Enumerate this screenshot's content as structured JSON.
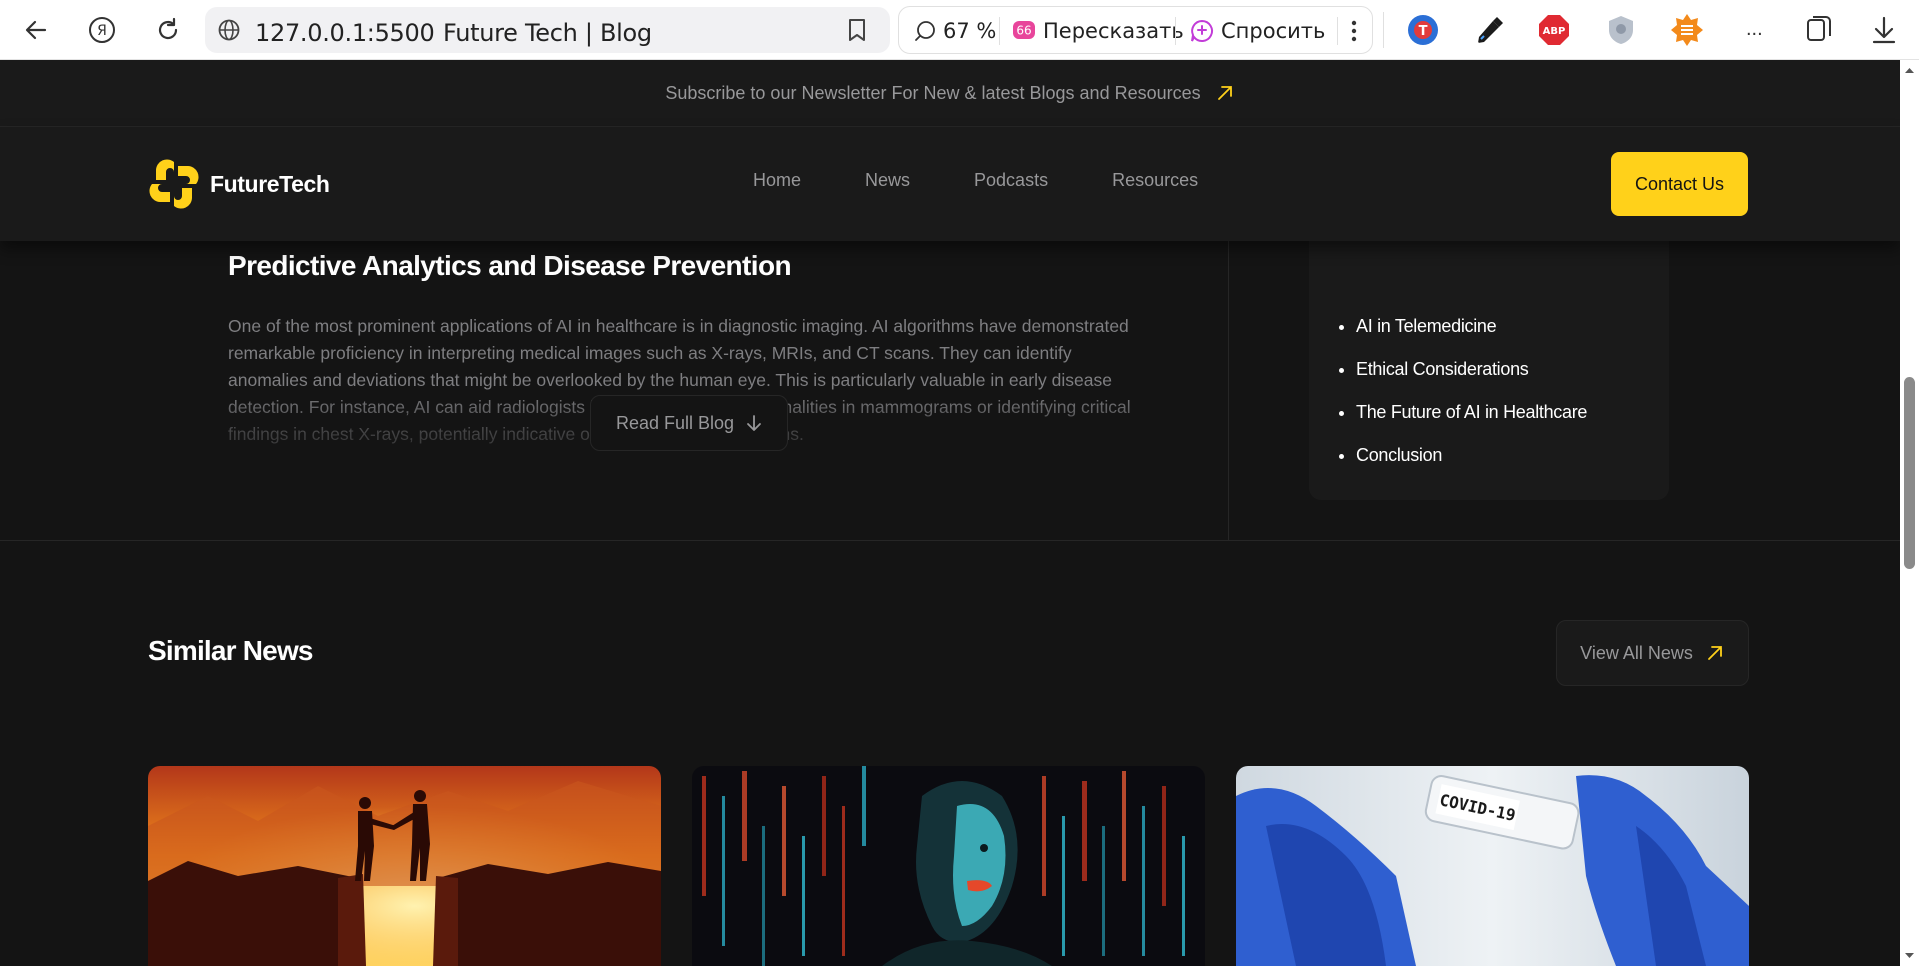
{
  "browser": {
    "url": "127.0.0.1:5500",
    "page_title": "Future Tech | Blog",
    "zoom": "67 %",
    "retell_label": "Пересказать",
    "ask_label": "Спросить",
    "more_ext": "..."
  },
  "site": {
    "newsletter_text": "Subscribe to our Newsletter For New & latest Blogs and Resources",
    "brand": "FutureTech",
    "nav": [
      "Home",
      "News",
      "Podcasts",
      "Resources"
    ],
    "contact_label": "Contact Us"
  },
  "article": {
    "heading": "Predictive Analytics and Disease Prevention",
    "body": "One of the most prominent applications of AI in healthcare is in diagnostic imaging. AI algorithms have demonstrated remarkable proficiency in interpreting medical images such as X-rays, MRIs, and CT scans. They can identify anomalies and deviations that might be overlooked by the human eye. This is particularly valuable in early disease detection. For instance, AI can aid radiologists in detecting minor abnormalities in mammograms or identifying critical findings in chest X-rays, potentially indicative of life-threatening conditions.",
    "read_label": "Read Full Blog"
  },
  "toc": {
    "items": [
      "AI in Telemedicine",
      "Ethical Considerations",
      "The Future of AI in Healthcare",
      "Conclusion"
    ]
  },
  "similar": {
    "title": "Similar News",
    "view_all_label": "View All News",
    "cards": [
      {
        "image": "handshake-canyon-image"
      },
      {
        "image": "digital-woman-portrait-image"
      },
      {
        "image": "covid-test-tube-image",
        "image_text": "COVID-19"
      }
    ]
  },
  "colors": {
    "accent": "#ffd11a",
    "background": "#141414",
    "panel": "#1a1a1a",
    "muted_text": "#98989a"
  }
}
